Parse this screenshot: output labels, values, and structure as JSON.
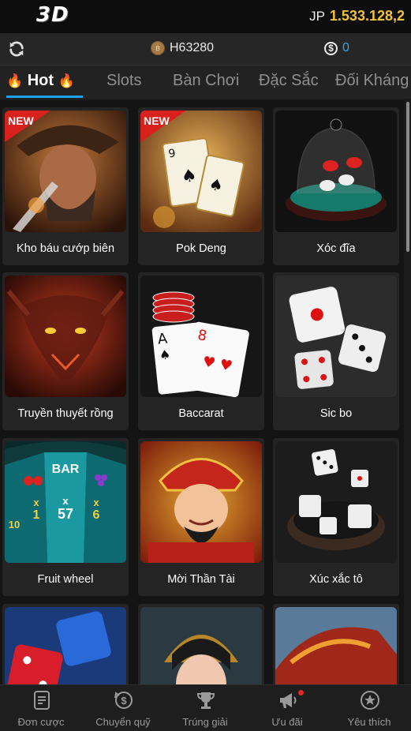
{
  "header": {
    "logo": "3D",
    "jp_label": "JP",
    "jp_value": "1.533.128,2"
  },
  "account": {
    "refresh_icon": "refresh-icon",
    "username": "H63280",
    "coin_icon": "coin-icon",
    "balance": "0",
    "balance_icon": "dollar-circle-icon"
  },
  "tabs": {
    "hot_label": "Hot",
    "slots_label": "Slots",
    "table_label": "Bàn Chơi",
    "special_label": "Đặc Sắc",
    "versus_label": "Đối Kháng"
  },
  "games": [
    {
      "name": "Kho báu cướp biên",
      "badge": "NEW"
    },
    {
      "name": "Pok Deng",
      "badge": "NEW"
    },
    {
      "name": "Xóc đĩa"
    },
    {
      "name": "Truyền thuyết rồng"
    },
    {
      "name": "Baccarat"
    },
    {
      "name": "Sic bo"
    },
    {
      "name": "Fruit wheel"
    },
    {
      "name": "Mời Thần Tài"
    },
    {
      "name": "Xúc xắc tô"
    },
    {
      "name": ""
    },
    {
      "name": ""
    },
    {
      "name": ""
    }
  ],
  "fruit_wheel_art": {
    "segments": [
      "BAR",
      "x",
      "57",
      "x",
      "1",
      "x",
      "6",
      "10"
    ]
  },
  "bottom_nav": [
    {
      "label": "Đơn cược",
      "icon": "receipt-icon"
    },
    {
      "label": "Chuyển quỹ",
      "icon": "transfer-money-icon"
    },
    {
      "label": "Trúng giải",
      "icon": "trophy-icon"
    },
    {
      "label": "Ưu đãi",
      "icon": "megaphone-icon"
    },
    {
      "label": "Yêu thích",
      "icon": "star-icon"
    }
  ],
  "colors": {
    "accent": "#19a0e8",
    "jackpot": "#f0c23b",
    "balance": "#2fa7e8",
    "badge": "#e02a2a"
  }
}
